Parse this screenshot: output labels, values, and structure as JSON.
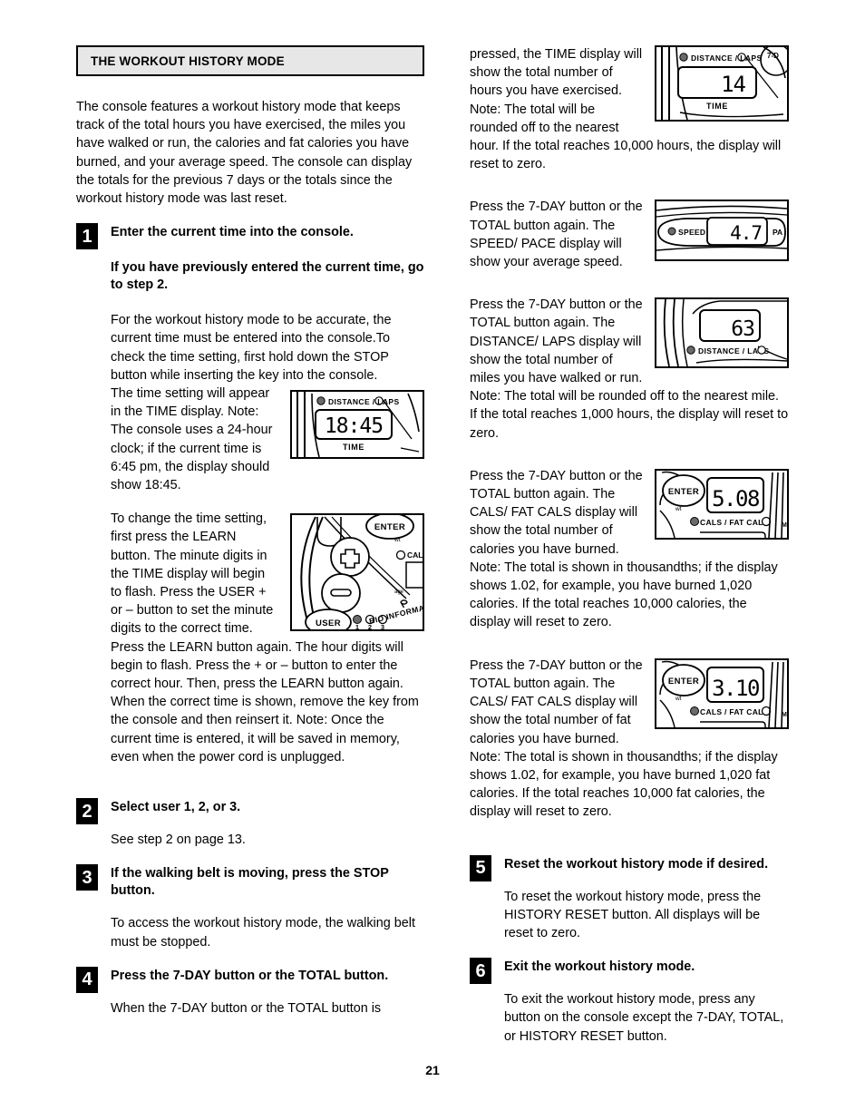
{
  "header": {
    "title": "THE WORKOUT HISTORY MODE"
  },
  "intro": "The console features a workout history mode that keeps track of the total hours you have exercised, the miles you have walked or run, the calories and fat calories you have burned, and your average speed. The console can display the totals for the previous 7 days or the totals since the workout history mode was last reset.",
  "steps": {
    "step1": {
      "number": "1",
      "title": "Enter the current time into the console.",
      "subtitle": "If you have previously entered the current time, go to step 2.",
      "para1": "For the workout history mode to be accurate, the current time must be entered into the console.To check the time setting, first hold down the STOP button while inserting the key into the console.",
      "para2": "The time setting will appear in the TIME display. Note: The console uses a 24-hour clock; if the current time is 6:45 pm, the display should show 18:45.",
      "para3": "To change the time setting, first press the LEARN button. The minute digits in the TIME display will begin to flash. Press the USER + or – button to set the minute digits to the correct time. Press the LEARN button again. The hour digits will begin to flash. Press the + or – button to enter the correct hour. Then, press the LEARN button again. When the correct time is shown, remove the key from the console and then reinsert it. Note: Once the current time is entered, it will be saved in memory, even when the power cord is unplugged."
    },
    "step2": {
      "number": "2",
      "title": "Select user 1, 2, or 3.",
      "para1": "See step 2 on page 13."
    },
    "step3": {
      "number": "3",
      "title": "If the walking belt is moving, press the STOP button.",
      "para1": "To access the workout history mode, the walking belt must be stopped."
    },
    "step4": {
      "number": "4",
      "title": "Press the 7-DAY button or the TOTAL button.",
      "para1": "When the 7-DAY button or the TOTAL button is",
      "para1_cont": "pressed, the TIME display will show the total number of hours you have exercised. Note: The total will be rounded off to the nearest hour. If the total reaches 10,000 hours, the display will reset to zero.",
      "para2": "Press the 7-DAY button or the TOTAL button again. The SPEED/ PACE display will show your average speed.",
      "para3": "Press the 7-DAY button or the TOTAL button again. The DISTANCE/ LAPS display will show the total number of miles you have walked or run. Note: The total will be rounded off to the nearest mile. If the total reaches 1,000 hours, the display will reset to zero.",
      "para4": "Press the 7-DAY button or the TOTAL button again. The CALS/ FAT CALS display will show the total number of calories you have burned. Note: The total is shown in thousandths; if the display shows 1.02, for example, you have burned 1,020 calories. If the total reaches 10,000 calories, the display will reset to zero.",
      "para5": "Press the 7-DAY button or the TOTAL button again. The CALS/ FAT CALS display will show the total number of fat calories you have burned. Note: The total is shown in thousandths; if the display shows 1.02, for example, you have burned 1,020 fat calories. If the total reaches 10,000 fat calories, the display will reset to zero."
    },
    "step5": {
      "number": "5",
      "title": "Reset the workout history mode if desired.",
      "para1": "To reset the workout history mode, press the HISTORY RESET button. All displays will be reset to zero."
    },
    "step6": {
      "number": "6",
      "title": "Exit the workout history mode.",
      "para1": "To exit the workout history mode, press any button on the console except the 7-DAY, TOTAL, or HISTORY RESET button."
    }
  },
  "figures": {
    "time_1845": {
      "label_top": "DISTANCE / LAPS",
      "value": "18:45",
      "label_bottom": "TIME"
    },
    "buttons_panel": {
      "enter": "ENTER",
      "user": "USER",
      "indicator_1": "1",
      "indicator_2": "2",
      "indicator_3": "3",
      "wt": "wt",
      "age": "age",
      "cals": "CALS",
      "bio": "BIO INFORMAT"
    },
    "time_14": {
      "label_top": "DISTANCE / LAPS",
      "value": "14",
      "label_bottom": "TIME",
      "corner": "7-D"
    },
    "speed_47": {
      "label_left": "SPEED",
      "value": "4.7",
      "label_right": "PA"
    },
    "distance_63": {
      "value": "63",
      "label_bottom": "DISTANCE / LAPS"
    },
    "cals_508": {
      "enter": "ENTER",
      "wt": "wt",
      "value": "5.08",
      "label_bottom": "CALS / FAT CALS",
      "edge": "M"
    },
    "fatcals_310": {
      "enter": "ENTER",
      "wt": "wt",
      "value": "3.10",
      "label_bottom": "CALS / FAT CALS",
      "edge": "M"
    }
  },
  "footer": {
    "page_number": "21"
  }
}
